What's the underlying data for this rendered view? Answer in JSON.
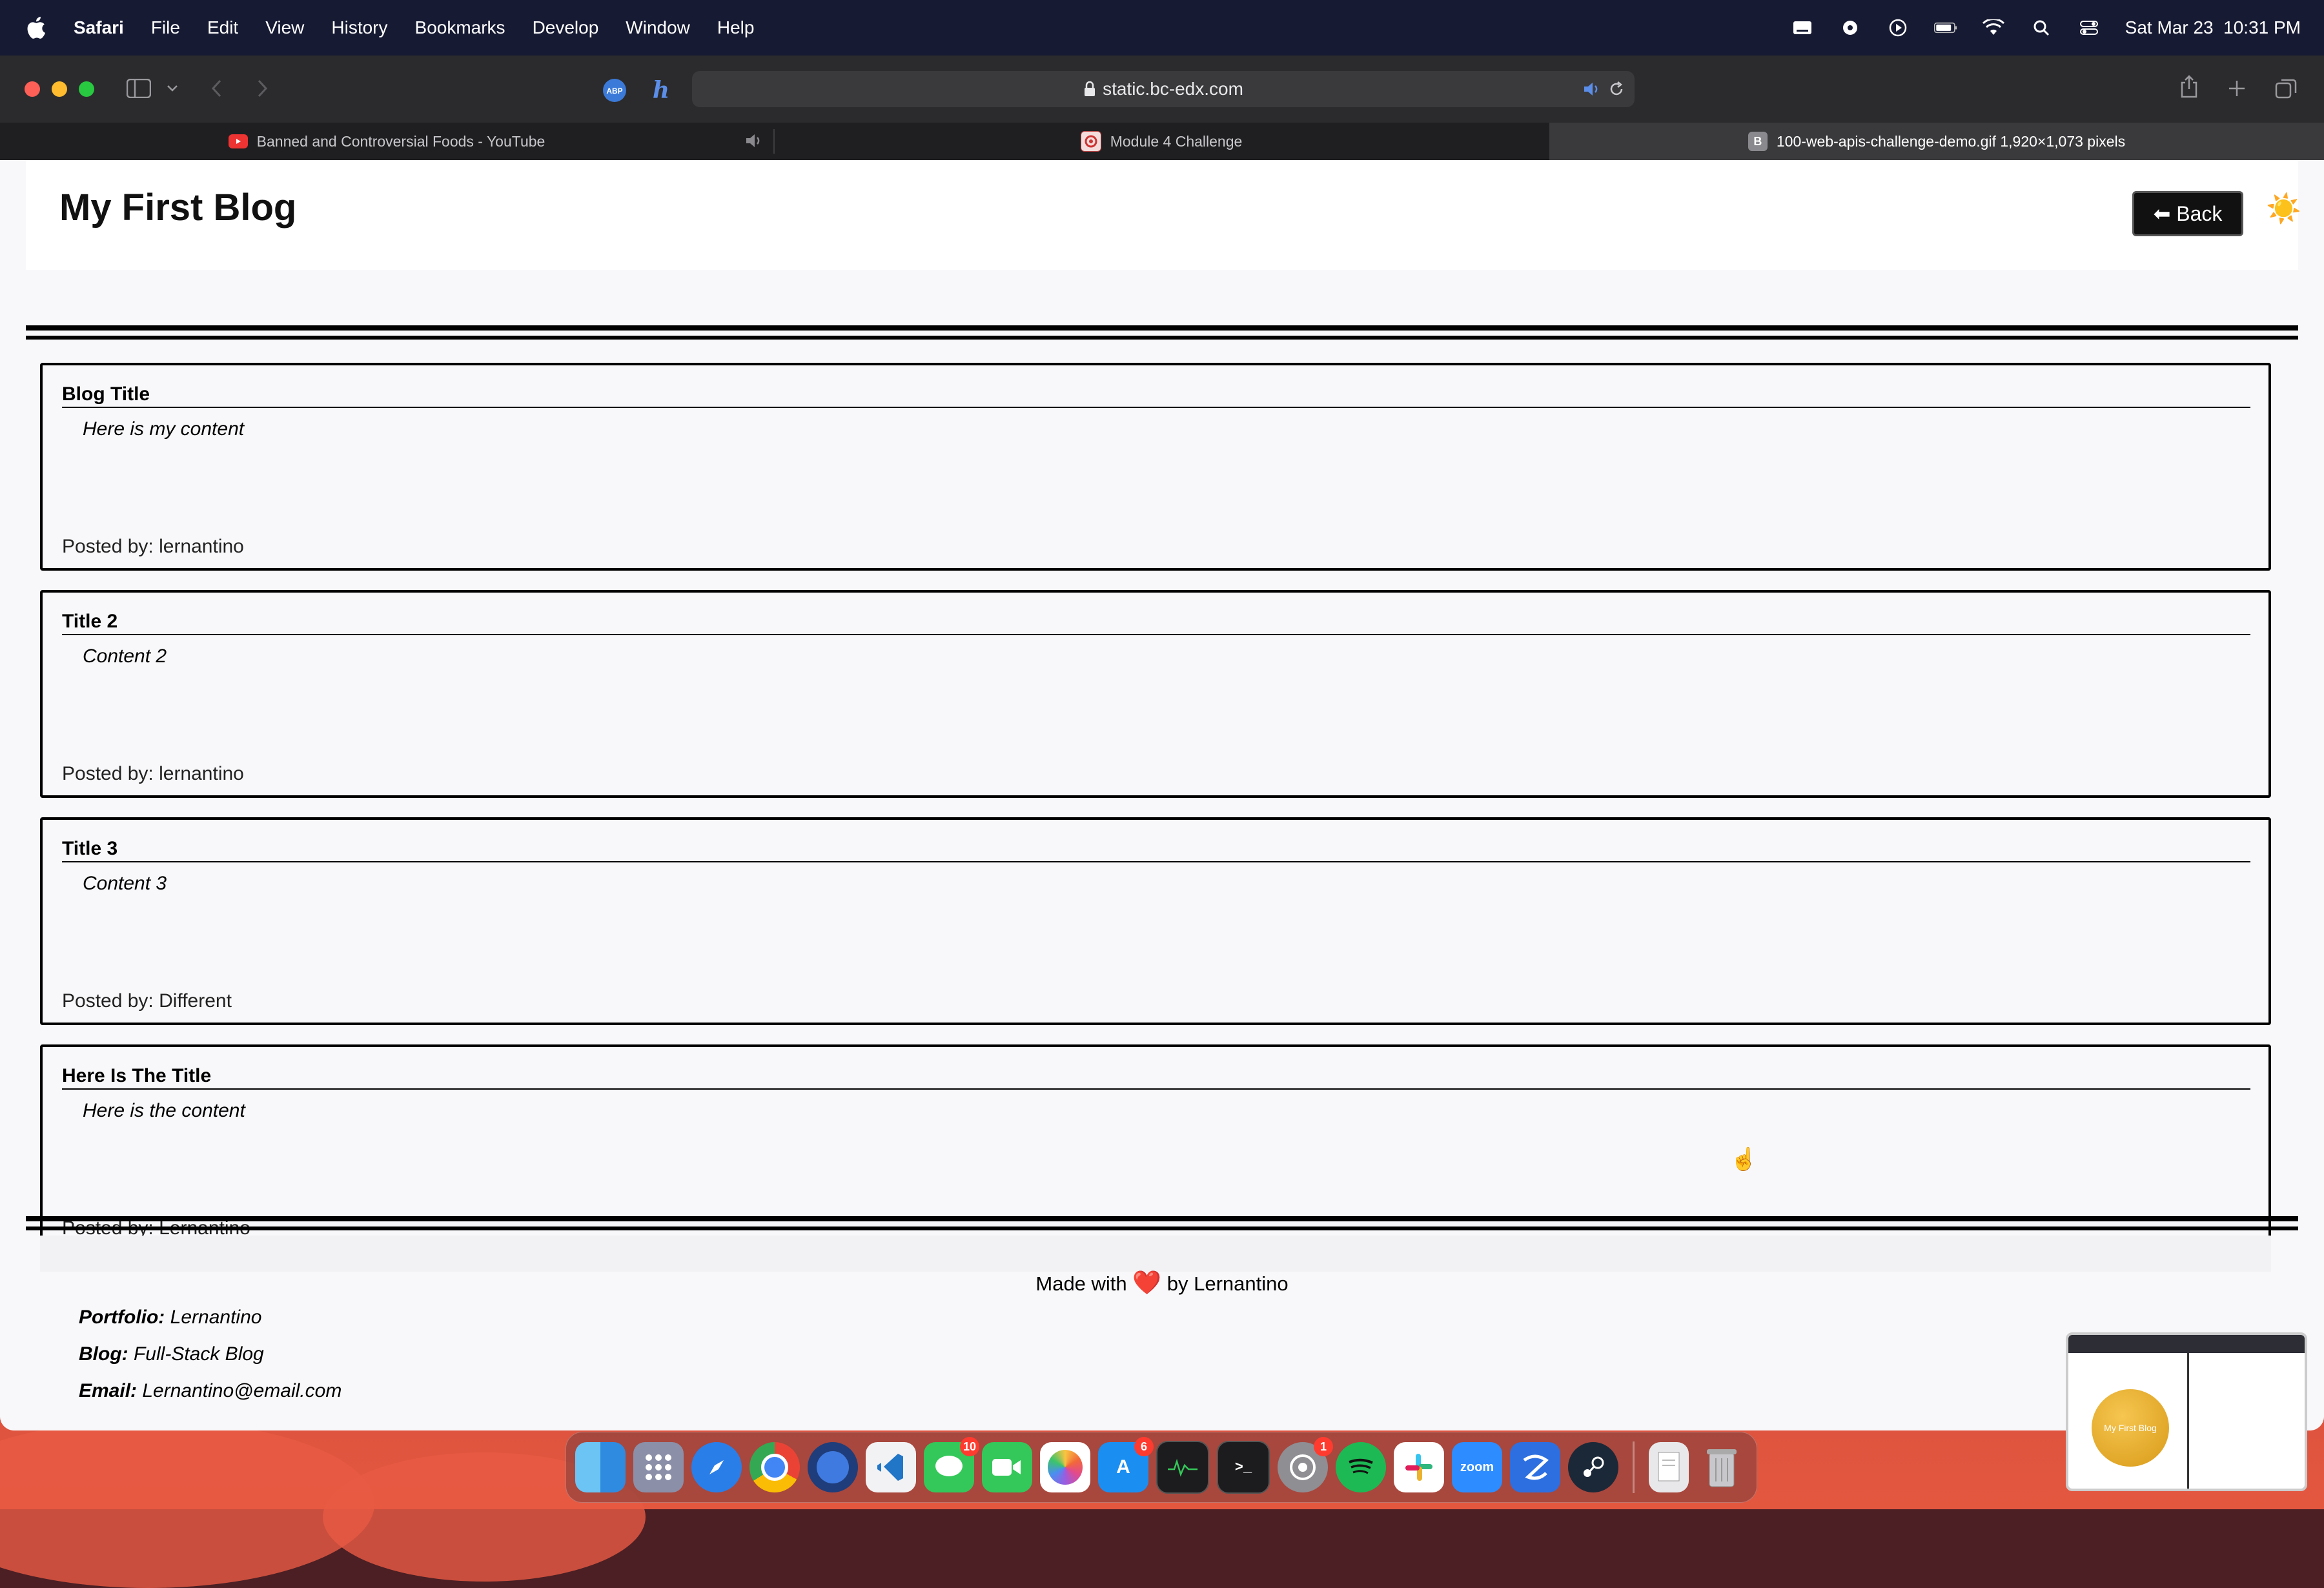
{
  "menubar": {
    "app": "Safari",
    "items": [
      "File",
      "Edit",
      "View",
      "History",
      "Bookmarks",
      "Develop",
      "Window",
      "Help"
    ],
    "datetime": "Sat Mar 23  10:31 PM"
  },
  "browser": {
    "url": "static.bc-edx.com",
    "tabs": [
      {
        "label": "Banned and Controversial Foods - YouTube",
        "favicon": "youtube-icon"
      },
      {
        "label": "Module 4 Challenge",
        "favicon": "module-icon"
      },
      {
        "label": "100-web-apis-challenge-demo.gif 1,920×1,073 pixels",
        "favicon": "B"
      }
    ]
  },
  "page": {
    "site_title": "My First Blog",
    "back_label": "⬅ Back",
    "theme_toggle": "☀️",
    "posts": [
      {
        "title": "Blog Title",
        "content": "Here is my content",
        "author": "Posted by: lernantino"
      },
      {
        "title": "Title 2",
        "content": "Content 2",
        "author": "Posted by: lernantino"
      },
      {
        "title": "Title 3",
        "content": "Content 3",
        "author": "Posted by: Different"
      },
      {
        "title": "Here Is The Title",
        "content": "Here is the content",
        "author": "Posted by: Lernantino"
      }
    ],
    "footer": {
      "made_with_prefix": "Made with",
      "heart": "❤️",
      "made_with_suffix": "by Lernantino",
      "links": [
        {
          "label": "Portfolio:",
          "value": "Lernantino"
        },
        {
          "label": "Blog:",
          "value": "Full-Stack Blog"
        },
        {
          "label": "Email:",
          "value": "Lernantino@email.com"
        }
      ]
    }
  },
  "dock": {
    "badges": {
      "messages": "10",
      "appstore": "6",
      "settings": "1"
    },
    "zoom_label": "zoom",
    "thumbnail_title": "My First Blog"
  },
  "colors": {
    "menubar": "#161a33",
    "toolbar": "#2b2b2d",
    "page_bg": "#f8f8fa",
    "heart": "#e02020"
  }
}
